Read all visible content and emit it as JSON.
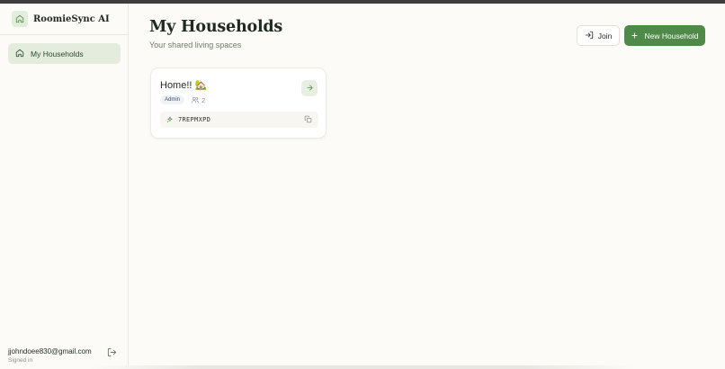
{
  "app": {
    "name": "RoomieSync AI"
  },
  "sidebar": {
    "items": [
      {
        "label": "My Households",
        "icon": "home-icon"
      }
    ]
  },
  "user": {
    "email": "jjohndoee830@gmail.com",
    "status": "Signed in"
  },
  "main": {
    "title": "My Households",
    "subtitle": "Your shared living spaces",
    "join_label": "Join",
    "new_household_label": "New Household"
  },
  "households": [
    {
      "name": "Home!! 🏡",
      "role": "Admin",
      "members": "2",
      "code": "7REPMXPD"
    }
  ],
  "colors": {
    "accent": "#4f8a48",
    "accent_light": "#e3ecdd",
    "background": "#fdfbf7"
  }
}
